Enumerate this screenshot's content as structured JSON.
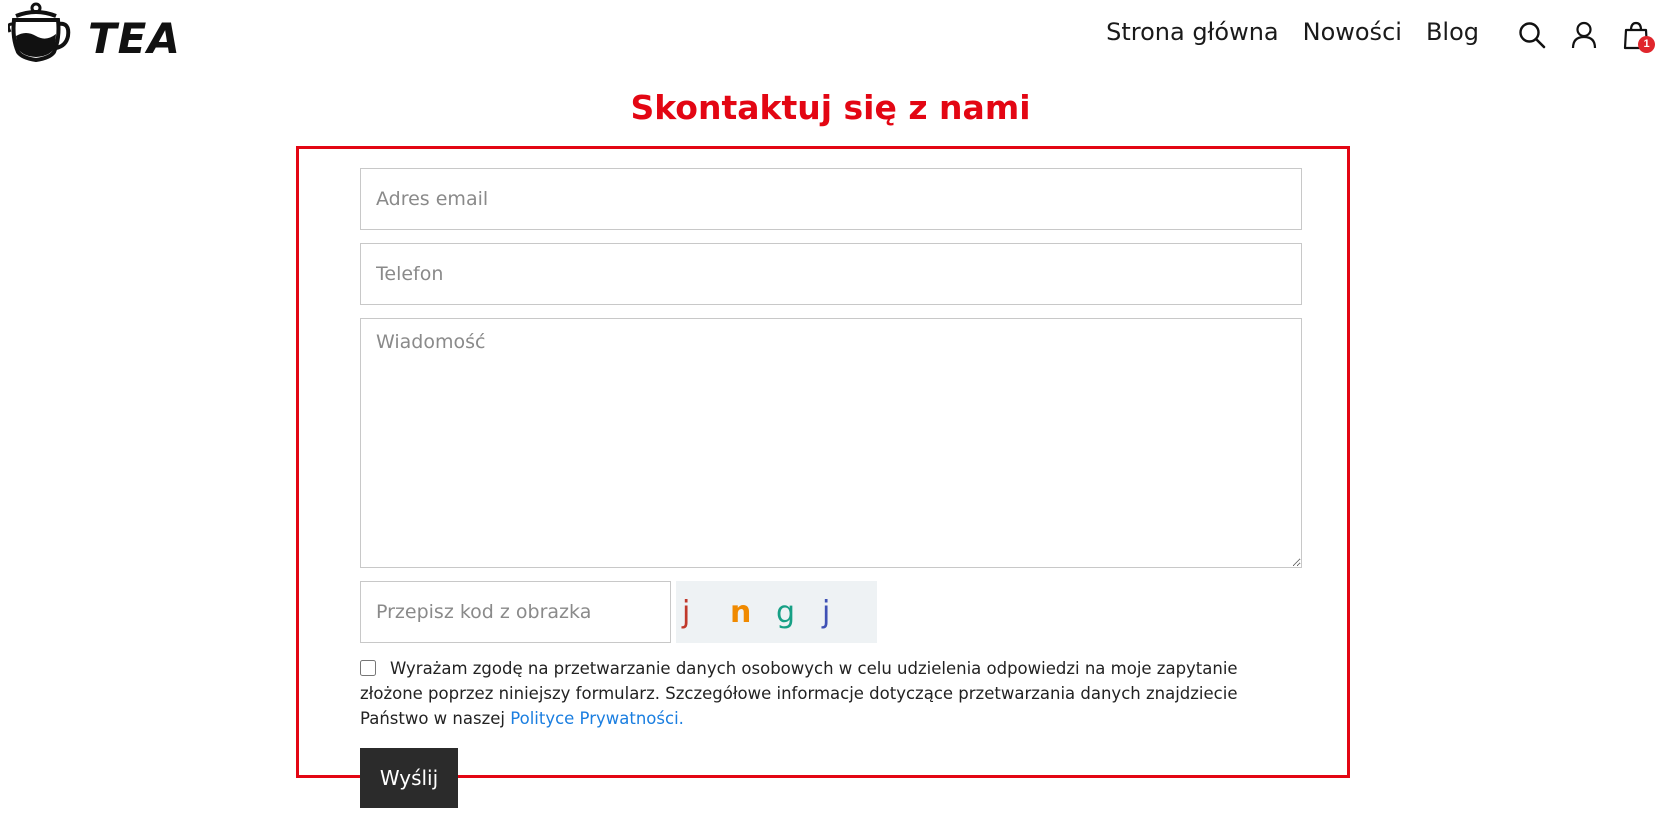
{
  "header": {
    "logo_text": "TEA",
    "nav": [
      "Strona główna",
      "Nowości",
      "Blog"
    ],
    "cart_count": "1"
  },
  "page_title": "Skontaktuj się z nami",
  "form": {
    "email_placeholder": "Adres email",
    "phone_placeholder": "Telefon",
    "message_placeholder": "Wiadomość",
    "captcha_placeholder": "Przepisz kod z obrazka",
    "captcha_chars": [
      {
        "char": "j",
        "color": "#c0392b"
      },
      {
        "char": "n",
        "color": "#f08a00"
      },
      {
        "char": "g",
        "color": "#16a085"
      },
      {
        "char": "j",
        "color": "#3f51b5"
      }
    ],
    "consent_text": "Wyrażam zgodę na przetwarzanie danych osobowych w celu udzielenia odpowiedzi na moje zapytanie złożone poprzez niniejszy formularz. Szczegółowe informacje dotyczące przetwarzania danych znajdziecie Państwo w naszej ",
    "consent_link": "Polityce Prywatności.",
    "consent_checked": false,
    "submit_label": "Wyślij"
  },
  "colors": {
    "title": "#e30613",
    "highlight_border": "#e30613",
    "link": "#1a7ee0",
    "button_bg": "#2b2b2b",
    "badge": "#e0262c"
  },
  "icons": [
    "teapot-logo-icon",
    "search-icon",
    "user-icon",
    "shopping-bag-icon"
  ]
}
